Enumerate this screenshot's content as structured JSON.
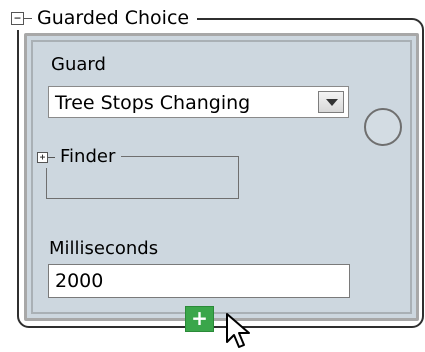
{
  "guarded_choice": {
    "title": "Guarded Choice",
    "collapse_icon": "minus-box-icon"
  },
  "guard": {
    "label": "Guard",
    "selected": "Tree Stops Changing",
    "dropdown_icon": "triangle-down-icon"
  },
  "status": {
    "icon": "circle-icon"
  },
  "finder": {
    "title": "Finder",
    "expand_icon": "plus-box-icon"
  },
  "milliseconds": {
    "label": "Milliseconds",
    "value": "2000"
  },
  "add": {
    "label": "+"
  },
  "colors": {
    "panel_bg": "#cdd7df",
    "add_button": "#3aa64a"
  }
}
